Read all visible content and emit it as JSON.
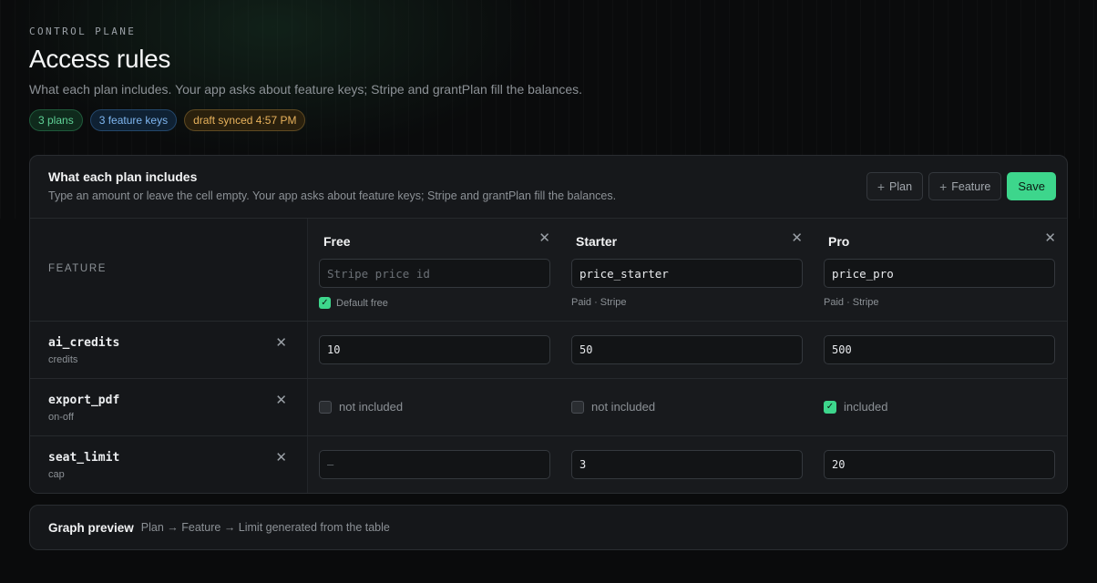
{
  "header": {
    "eyebrow": "CONTROL PLANE",
    "title": "Access rules",
    "subtitle": "What each plan includes. Your app asks about feature keys; Stripe and grantPlan fill the balances.",
    "badges": [
      "3 plans",
      "3 feature keys",
      "draft synced 4:57 PM"
    ]
  },
  "card": {
    "title": "What each plan includes",
    "subtitle": "Type an amount or leave the cell empty. Your app asks about feature keys; Stripe and grantPlan fill the balances.",
    "actions": {
      "add_plan": "Plan",
      "add_feature": "Feature",
      "save": "Save"
    },
    "feature_header": "FEATURE",
    "plans": [
      {
        "name": "Free",
        "price_id": "",
        "price_placeholder": "Stripe price id",
        "meta": "Default free",
        "default_free": true
      },
      {
        "name": "Starter",
        "price_id": "price_starter",
        "price_placeholder": "Stripe price id",
        "meta": "Paid · Stripe"
      },
      {
        "name": "Pro",
        "price_id": "price_pro",
        "price_placeholder": "Stripe price id",
        "meta": "Paid · Stripe"
      }
    ],
    "features": [
      {
        "key": "ai_credits",
        "type": "credits",
        "values": [
          "10",
          "50",
          "500"
        ]
      },
      {
        "key": "export_pdf",
        "type": "on-off",
        "toggles": [
          {
            "checked": false,
            "label": "not included"
          },
          {
            "checked": false,
            "label": "not included"
          },
          {
            "checked": true,
            "label": "included"
          }
        ]
      },
      {
        "key": "seat_limit",
        "type": "cap",
        "values": [
          "",
          "3",
          "20"
        ],
        "empty_placeholder": "—"
      }
    ]
  },
  "preview": {
    "title": "Graph preview",
    "subtitle": "Plan → Feature → Limit generated from the table"
  },
  "colors": {
    "accent": "#3dd68c",
    "background": "#0a0b0c",
    "card": "#16181b"
  },
  "icons": {
    "close": "close-icon",
    "add": "plus-icon",
    "check": "check-icon"
  }
}
